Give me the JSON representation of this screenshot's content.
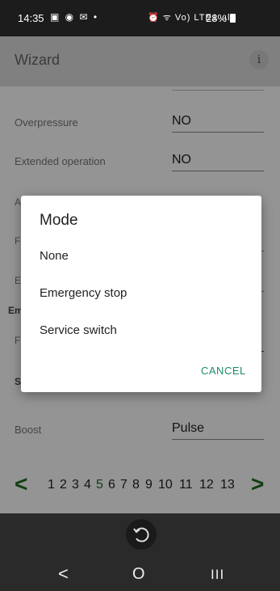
{
  "status_bar": {
    "time": "14:35",
    "left_icons": "▣ ◉ ✉ •",
    "right_icons": "⏰ ᯤ Vo) LTE1 .ıl",
    "battery": "28%"
  },
  "app_bar": {
    "title": "Wizard",
    "info_icon": "i"
  },
  "rows": [
    {
      "label": "Overpressure",
      "value": "NO"
    },
    {
      "label": "Extended operation",
      "value": "NO"
    },
    {
      "label": "Boost",
      "value": "Pulse"
    }
  ],
  "partial_labels": {
    "a": "A",
    "f1": "F",
    "e": "E",
    "em": "Em",
    "f2": "F",
    "s": "S"
  },
  "pager": {
    "prev": "<",
    "next": ">",
    "pages": [
      "1",
      "2",
      "3",
      "4",
      "5",
      "6",
      "7",
      "8",
      "9",
      "10",
      "11",
      "12",
      "13"
    ],
    "current": "5",
    "accent_color": "#1e6b1e"
  },
  "dialog": {
    "title": "Mode",
    "options": [
      "None",
      "Emergency stop",
      "Service switch"
    ],
    "cancel_label": "CANCEL",
    "accent_color": "#1b8a6b"
  },
  "nav": {
    "back_icon": "⟲",
    "recent_icon": "III",
    "home_icon": "O",
    "prev_icon": "<"
  }
}
